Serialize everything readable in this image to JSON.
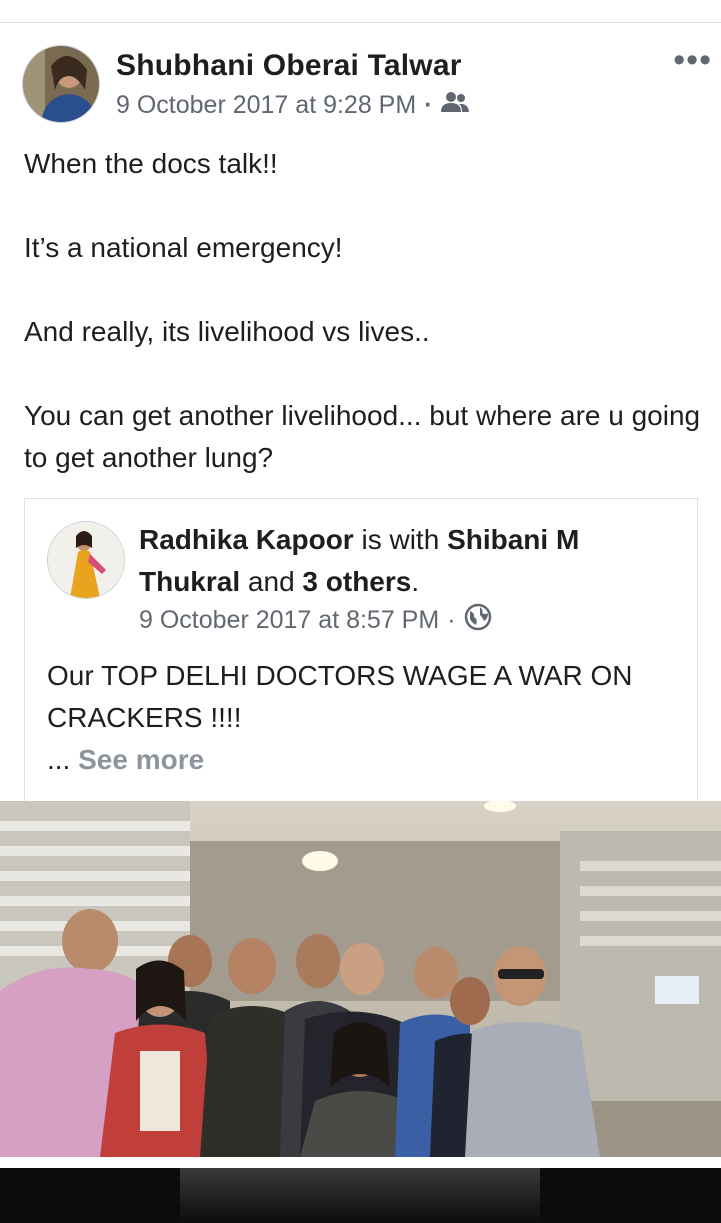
{
  "post": {
    "author": "Shubhani Oberai Talwar",
    "timestamp": "9 October 2017 at 9:28 PM",
    "separator": "·",
    "privacy_icon": "friends-icon",
    "more_icon": "more-options-icon",
    "more_label": "•••",
    "paragraphs": [
      "When the docs talk!!",
      "It’s a national emergency!",
      "And really, its livelihood vs lives..",
      "You can get another livelihood... but where are u going to get another lung?"
    ]
  },
  "shared_post": {
    "author": "Radhika Kapoor",
    "with_text": "is with",
    "tagged_name": "Shibani M Thukral",
    "and_text": "and",
    "others_text": "3 others",
    "period": ".",
    "timestamp": "9 October 2017 at 8:57 PM",
    "separator": "·",
    "privacy_icon": "globe-icon",
    "text": "Our TOP DELHI DOCTORS WAGE A WAR ON CRACKERS !!!!",
    "ellipsis": "...",
    "see_more": "See more"
  },
  "colors": {
    "text": "#1c1e21",
    "meta": "#606770",
    "see_more": "#8d949e",
    "border": "#dddfe2"
  }
}
